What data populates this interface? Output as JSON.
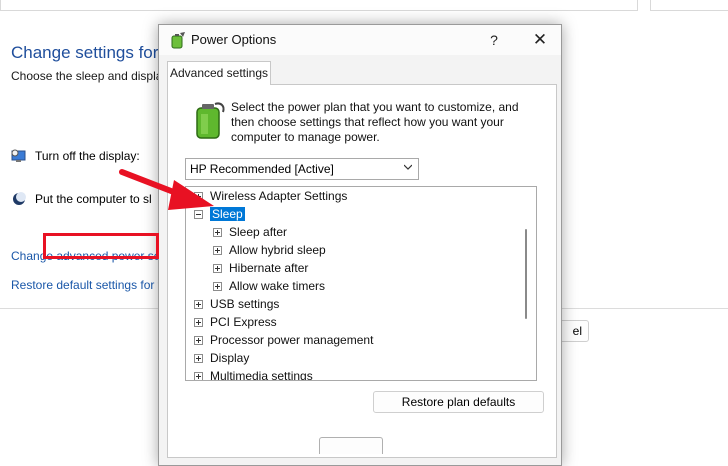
{
  "background": {
    "title": "Change settings for th",
    "subtitle": "Choose the sleep and displa",
    "rows": [
      {
        "label": "Turn off the display:",
        "icon": "monitor-sleep-icon"
      },
      {
        "label": "Put the computer to sl",
        "icon": "moon-sleep-icon"
      }
    ],
    "links": [
      "Change advanced power set",
      "Restore default settings for t"
    ],
    "cancel_label": "el"
  },
  "dialog": {
    "title": "Power Options",
    "help_label": "?",
    "close_label": "✕",
    "tab": "Advanced settings",
    "intro": "Select the power plan that you want to customize, and then choose settings that reflect how you want your computer to manage power.",
    "plan": "HP Recommended [Active]",
    "tree": [
      {
        "label": "Wireless Adapter Settings",
        "expanded": false,
        "level": 0
      },
      {
        "label": "Sleep",
        "expanded": true,
        "level": 0,
        "selected": true
      },
      {
        "label": "Sleep after",
        "expanded": false,
        "level": 1
      },
      {
        "label": "Allow hybrid sleep",
        "expanded": false,
        "level": 1
      },
      {
        "label": "Hibernate after",
        "expanded": false,
        "level": 1
      },
      {
        "label": "Allow wake timers",
        "expanded": false,
        "level": 1
      },
      {
        "label": "USB settings",
        "expanded": false,
        "level": 0
      },
      {
        "label": "PCI Express",
        "expanded": false,
        "level": 0
      },
      {
        "label": "Processor power management",
        "expanded": false,
        "level": 0
      },
      {
        "label": "Display",
        "expanded": false,
        "level": 0
      },
      {
        "label": "Multimedia settings",
        "expanded": false,
        "level": 0
      }
    ],
    "restore_label": "Restore plan defaults"
  },
  "colors": {
    "selection": "#0078d7",
    "highlight": "#e81123",
    "arrow": "#e81123",
    "link": "#1a57a8"
  }
}
